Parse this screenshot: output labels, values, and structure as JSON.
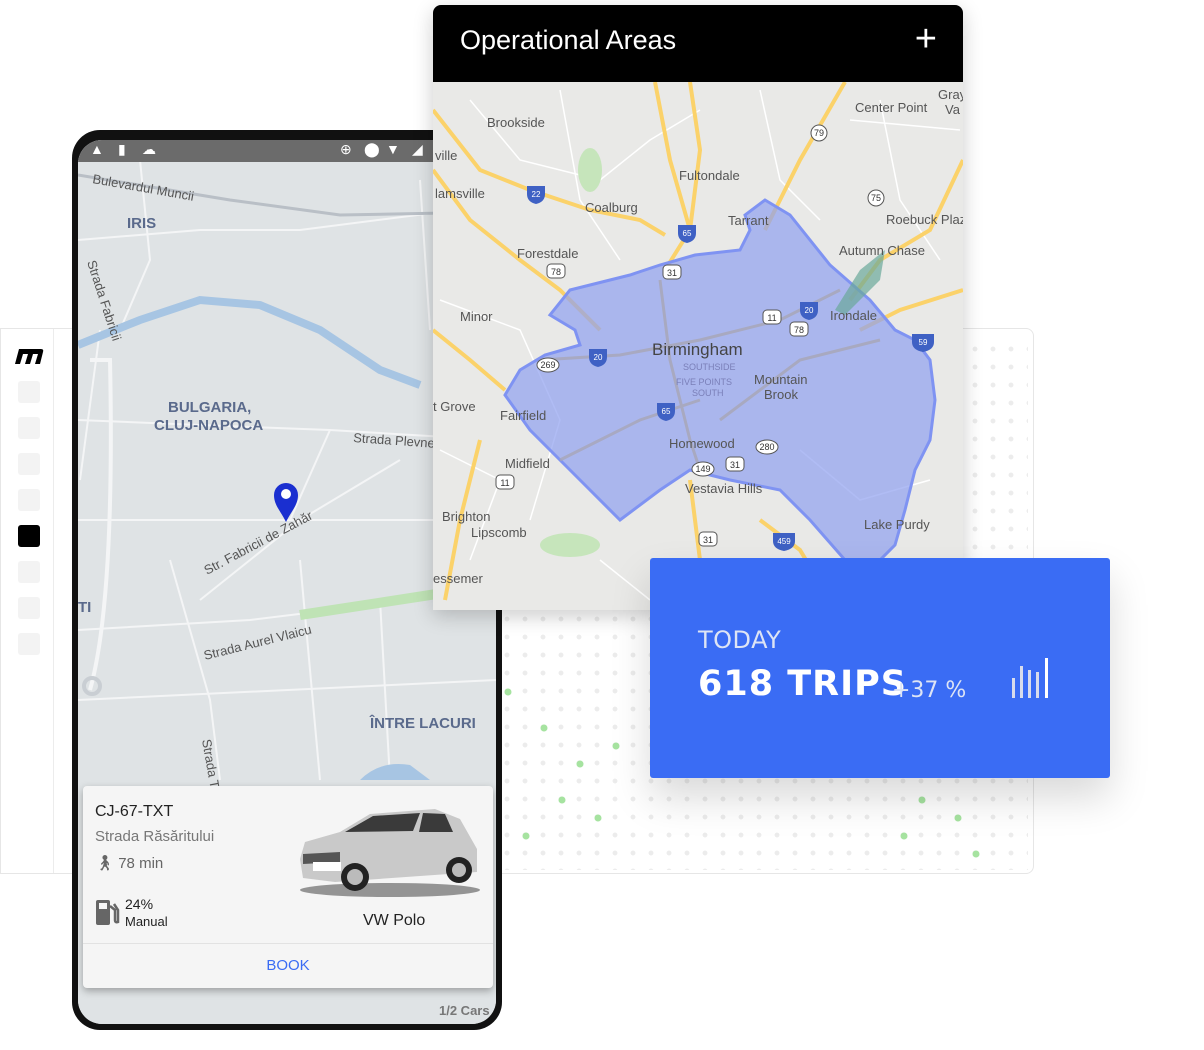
{
  "dashboard": {
    "sidebar_items": 8,
    "active_item_index": 4
  },
  "phone": {
    "status_icons": [
      "drive-icon",
      "sd-card-icon",
      "cloud-icon",
      "data-saver-icon",
      "location-icon",
      "wifi-icon",
      "signal-icon"
    ],
    "map_labels": {
      "road1": "Bulevardul Muncii",
      "area1": "IRIS",
      "road2": "Strada Fabricii",
      "area2a": "BULGARIA,",
      "area2b": "CLUJ-NAPOCA",
      "road3": "Strada Plevnei",
      "road4": "Str. Fabricii de Zahăr",
      "road5": "Strada Aurel Vlaicu",
      "area3": "ÎNTRE LACURI",
      "area4": "TI",
      "road6": "Strada Te"
    },
    "car": {
      "plate": "CJ-67-TXT",
      "street": "Strada Răsăritului",
      "walk_time": "78 min",
      "fuel": "24%",
      "transmission": "Manual",
      "model": "VW Polo",
      "book_label": "BOOK"
    },
    "cars_count": "1/2 Cars"
  },
  "operational_areas": {
    "title": "Operational Areas",
    "add_label": "+",
    "map_labels": {
      "l1": "Brookside",
      "l2": "Fultondale",
      "l3": "Center Point",
      "l4": "ville",
      "l5": "lamsville",
      "l6": "Coalburg",
      "l7": "Tarrant",
      "l8": "Roebuck Plaz",
      "l9": "Forestdale",
      "l10": "Autumn Chase",
      "l11": "Minor",
      "l12": "Irondale",
      "l13": "Birmingham",
      "l14": "SOUTHSIDE",
      "l15": "FIVE POINTS",
      "l16": "SOUTH",
      "l17": "Mountain",
      "l18": "Brook",
      "l19": "t Grove",
      "l20": "Fairfield",
      "l21": "Homewood",
      "l22": "Midfield",
      "l23": "Vestavia Hills",
      "l24": "Brighton",
      "l25": "Lipscomb",
      "l26": "Lake Purdy",
      "l27": "essemer",
      "l28": "Gray",
      "l29": "Va"
    },
    "shields": [
      "79",
      "22",
      "65",
      "75",
      "31",
      "78",
      "11",
      "20",
      "78",
      "269",
      "20",
      "65",
      "280",
      "149",
      "31",
      "11",
      "31",
      "459",
      "59"
    ],
    "area_color": "#8f9ff0"
  },
  "stats": {
    "label": "TODAY",
    "value": "618 TRIPS",
    "change": "+37 %",
    "color": "#3a6cf4"
  }
}
